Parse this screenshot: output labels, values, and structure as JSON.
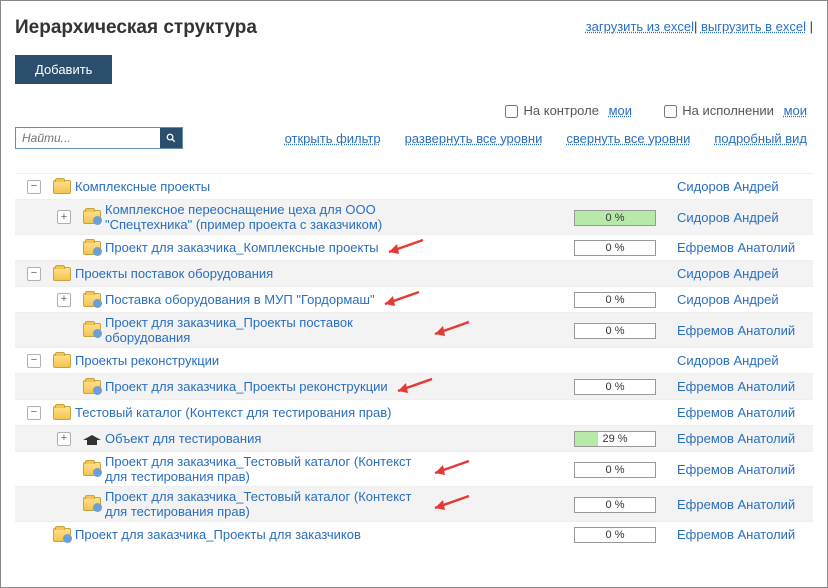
{
  "header": {
    "title": "Иерархическая структура",
    "load_from_excel": "загрузить из excel",
    "export_to_excel": "выгрузить в excel",
    "add_button": "Добавить"
  },
  "filterbar": {
    "on_control_label": "На контроле",
    "on_control_link": "мои",
    "on_exec_label": "На исполнении",
    "on_exec_link": "мои",
    "search_placeholder": "Найти...",
    "open_filter": "открыть фильтр",
    "expand_all": "развернуть все уровни",
    "collapse_all": "свернуть все уровни",
    "detailed_view": "подробный вид"
  },
  "owners": {
    "sidorov": "Сидоров Андрей",
    "efremov": "Ефремов Анатолий"
  },
  "rows": [
    {
      "indent": 0,
      "toggle": "-",
      "icon": "folder",
      "title": "Комплексные проекты",
      "progress": null,
      "owner": "sidorov",
      "striped": false
    },
    {
      "indent": 1,
      "toggle": "+",
      "icon": "folder-people",
      "title": "Комплексное переоснащение цеха для ООО \"Спецтехника\" (пример проекта с заказчиком)",
      "progress": {
        "pct": "0 %",
        "fill": "green-full"
      },
      "owner": "sidorov",
      "striped": true
    },
    {
      "indent": 1,
      "toggle": null,
      "icon": "folder-people",
      "title": "Проект для заказчика_Комплексные проекты",
      "progress": {
        "pct": "0 %",
        "fill": null
      },
      "owner": "efremov",
      "striped": false,
      "arrow": true
    },
    {
      "indent": 0,
      "toggle": "-",
      "icon": "folder",
      "title": "Проекты поставок оборудования",
      "progress": null,
      "owner": "sidorov",
      "striped": true
    },
    {
      "indent": 1,
      "toggle": "+",
      "icon": "folder-people",
      "title": "Поставка оборудования в МУП \"Гордормаш\"",
      "progress": {
        "pct": "0 %",
        "fill": null
      },
      "owner": "sidorov",
      "striped": false,
      "arrow": true
    },
    {
      "indent": 1,
      "toggle": null,
      "icon": "folder-people",
      "title": "Проект для заказчика_Проекты поставок оборудования",
      "progress": {
        "pct": "0 %",
        "fill": null
      },
      "owner": "efremov",
      "striped": true,
      "arrow": true
    },
    {
      "indent": 0,
      "toggle": "-",
      "icon": "folder",
      "title": "Проекты реконструкции",
      "progress": null,
      "owner": "sidorov",
      "striped": false
    },
    {
      "indent": 1,
      "toggle": null,
      "icon": "folder-people",
      "title": "Проект для заказчика_Проекты реконструкции",
      "progress": {
        "pct": "0 %",
        "fill": null
      },
      "owner": "efremov",
      "striped": true,
      "arrow": true
    },
    {
      "indent": 0,
      "toggle": "-",
      "icon": "folder",
      "title": "Тестовый каталог (Контекст для тестирования прав)",
      "progress": null,
      "owner": "efremov",
      "striped": false
    },
    {
      "indent": 1,
      "toggle": "+",
      "icon": "grad",
      "title": "Объект для тестирования",
      "progress": {
        "pct": "29 %",
        "fill": "green-part"
      },
      "owner": "efremov",
      "striped": true
    },
    {
      "indent": 1,
      "toggle": null,
      "icon": "folder-people",
      "title": "Проект для заказчика_Тестовый каталог (Контекст для тестирования прав)",
      "progress": {
        "pct": "0 %",
        "fill": null
      },
      "owner": "efremov",
      "striped": false,
      "arrow": true
    },
    {
      "indent": 1,
      "toggle": null,
      "icon": "folder-people",
      "title": "Проект для заказчика_Тестовый каталог (Контекст для тестирования прав)",
      "progress": {
        "pct": "0 %",
        "fill": null
      },
      "owner": "efremov",
      "striped": true,
      "arrow": true
    },
    {
      "indent": 0,
      "toggle": null,
      "icon": "folder-people",
      "title": "Проект для заказчика_Проекты для заказчиков",
      "progress": {
        "pct": "0 %",
        "fill": null
      },
      "owner": "efremov",
      "striped": false
    }
  ]
}
